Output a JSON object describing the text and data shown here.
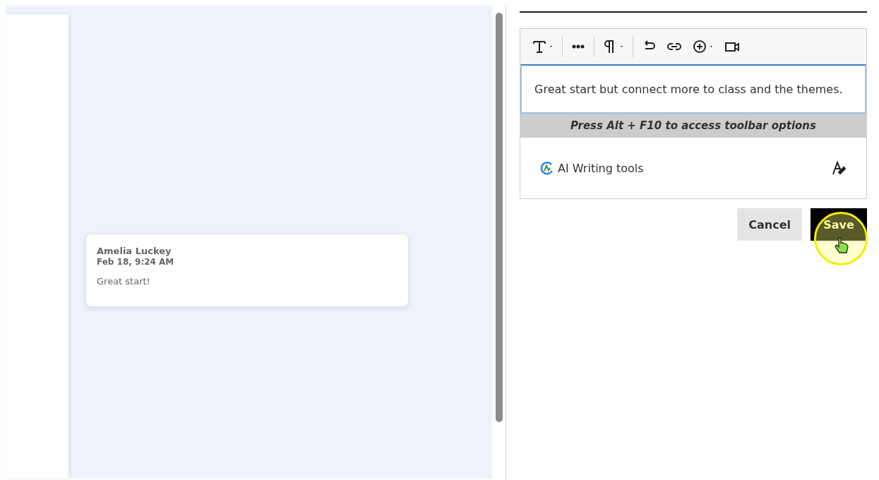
{
  "comment": {
    "author": "Amelia Luckey",
    "time": "Feb 18, 9:24 AM",
    "text": "Great start!"
  },
  "editor": {
    "value": "Great start but connect more to class and the themes.",
    "hint": "Press Alt + F10 to access toolbar options",
    "ai_tools": "AI Writing tools"
  },
  "buttons": [
    {
      "label": "Cancel",
      "kind": "secondary"
    },
    {
      "label": "Save",
      "kind": "primary"
    }
  ]
}
